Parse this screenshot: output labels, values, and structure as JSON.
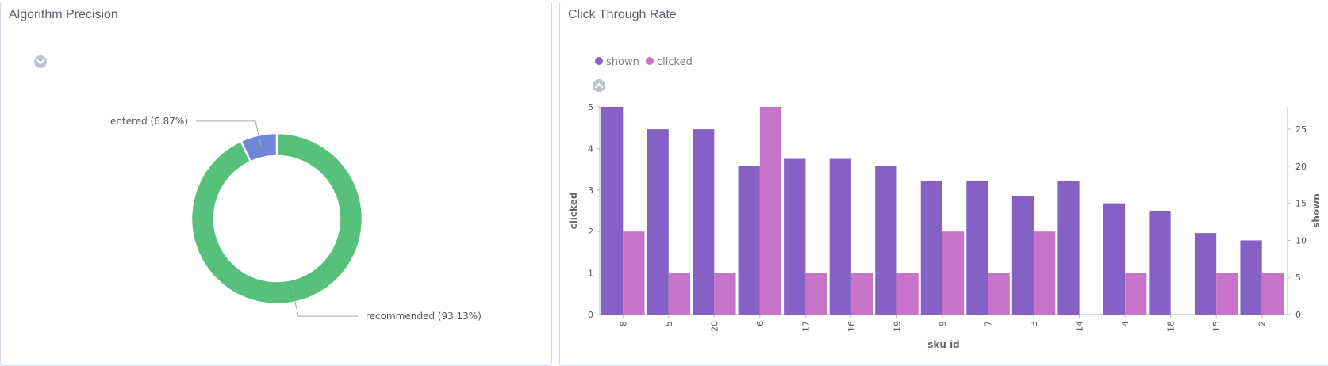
{
  "left_panel": {
    "title": "Algorithm Precision",
    "legend_toggle_icon": "chevron-down-circle-icon"
  },
  "right_panel": {
    "title": "Click Through Rate",
    "legend_toggle_icon": "chevron-up-circle-icon"
  },
  "chart_data": [
    {
      "type": "pie",
      "donut": true,
      "slices": [
        {
          "label": "recommended (93.13%)",
          "value": 93.13,
          "color": "#57c17b"
        },
        {
          "label": "entered (6.87%)",
          "value": 6.87,
          "color": "#6f87d8"
        }
      ]
    },
    {
      "type": "bar",
      "xlabel": "sku id",
      "categories": [
        "8",
        "5",
        "20",
        "6",
        "17",
        "16",
        "19",
        "9",
        "7",
        "3",
        "14",
        "4",
        "18",
        "15",
        "2"
      ],
      "series": [
        {
          "name": "shown",
          "axis": "right",
          "color": "#8661c5",
          "values": [
            28,
            25,
            25,
            20,
            21,
            21,
            20,
            18,
            18,
            16,
            18,
            15,
            14,
            11,
            10
          ]
        },
        {
          "name": "clicked",
          "axis": "left",
          "color": "#c774c8",
          "values": [
            2,
            1,
            1,
            5,
            1,
            1,
            1,
            2,
            1,
            2,
            0,
            1,
            0,
            1,
            1
          ]
        }
      ],
      "y_left": {
        "label": "clicked",
        "ticks": [
          0,
          1,
          2,
          3,
          4,
          5
        ]
      },
      "y_right": {
        "label": "shown",
        "ticks": [
          0,
          5,
          10,
          15,
          20,
          25
        ]
      }
    }
  ]
}
